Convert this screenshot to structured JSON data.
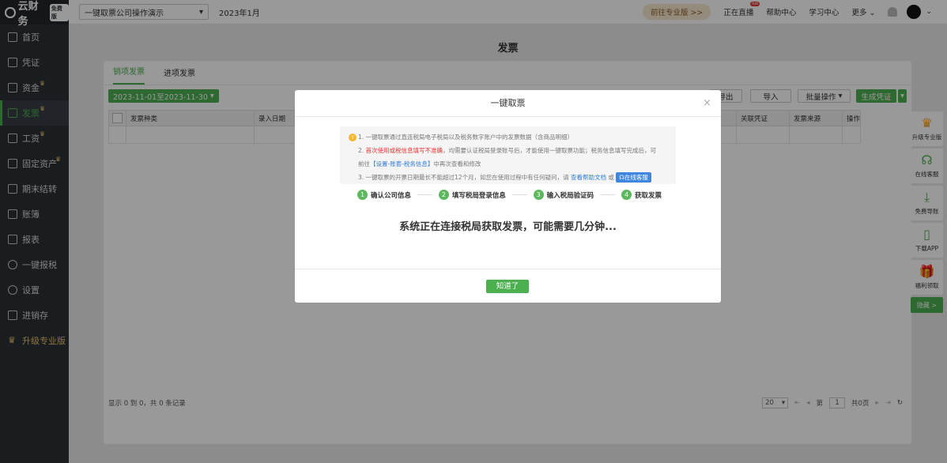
{
  "app": {
    "logo": "云财务",
    "logo_tag": "免费版"
  },
  "sidebar": {
    "items": [
      {
        "label": "首页",
        "crown": false
      },
      {
        "label": "凭证",
        "crown": false
      },
      {
        "label": "资金",
        "crown": true
      },
      {
        "label": "发票",
        "crown": true,
        "active": true
      },
      {
        "label": "工资",
        "crown": true
      },
      {
        "label": "固定资产",
        "crown": true
      },
      {
        "label": "期末结转",
        "crown": false
      },
      {
        "label": "账簿",
        "crown": false
      },
      {
        "label": "报表",
        "crown": false
      },
      {
        "label": "一键报税",
        "crown": false
      },
      {
        "label": "设置",
        "crown": false
      },
      {
        "label": "进销存",
        "crown": false
      },
      {
        "label": "升级专业版",
        "crown": false
      }
    ]
  },
  "topbar": {
    "company": "一键取票公司操作演示",
    "period": "2023年1月",
    "pro_button": "前往专业版 >>",
    "live": "正在直播",
    "live_badge": "hot",
    "help": "帮助中心",
    "learn": "学习中心",
    "more": "更多"
  },
  "page": {
    "title": "发票"
  },
  "tabs": [
    "销项发票",
    "进项发票"
  ],
  "toolbar": {
    "daterange": "2023-11-01至2023-11-30",
    "export": "导出",
    "import": "导入",
    "batch": "批量操作",
    "generate": "生成凭证"
  },
  "table": {
    "headers": [
      "发票种类",
      "录入日期",
      "关联凭证",
      "发票来源",
      "操作"
    ]
  },
  "footer": {
    "record_info": "显示 0 到 0，共 0 条记录",
    "page_size": "20",
    "page_prefix": "第",
    "page_num": "1",
    "page_suffix": "共0页"
  },
  "rightbar": [
    {
      "label": "升级专业版",
      "icon": "crown-icon"
    },
    {
      "label": "在线客服",
      "icon": "headset-icon"
    },
    {
      "label": "免费导账",
      "icon": "download-icon"
    },
    {
      "label": "下载APP",
      "icon": "phone-icon"
    },
    {
      "label": "福利领取",
      "icon": "gift-icon"
    }
  ],
  "rightbar_hide": "隐藏 >",
  "modal": {
    "title": "一键取票",
    "notice": {
      "line1": "1. 一键取票通过直连税局电子税局以及税务数字账户中的发票数据（含商品明细）",
      "line2_num": "2. ",
      "line2_red": "首次使用或税信息填写不准确",
      "line2_rest": "，均需要认证税局登录账号后，才能使用一键取票功能；税务信息填写完成后，可",
      "line2b_pre": "前往",
      "line2b_link": "【设置-账套-税务信息】",
      "line2b_post": "中再次查看和修改",
      "line3_pre": "3. 一键取票的开票日期最长不能超过12个月，如您在使用过程中有任何疑问，请",
      "line3_link": "查看帮助文档",
      "line3_or": "或",
      "cs_button": "在线客服"
    },
    "steps": [
      {
        "num": "1",
        "label": "确认公司信息"
      },
      {
        "num": "2",
        "label": "填写税局登录信息"
      },
      {
        "num": "3",
        "label": "输入税局验证码"
      },
      {
        "num": "4",
        "label": "获取发票"
      }
    ],
    "message": "系统正在连接税局获取发票，可能需要几分钟...",
    "ok_button": "知道了"
  }
}
